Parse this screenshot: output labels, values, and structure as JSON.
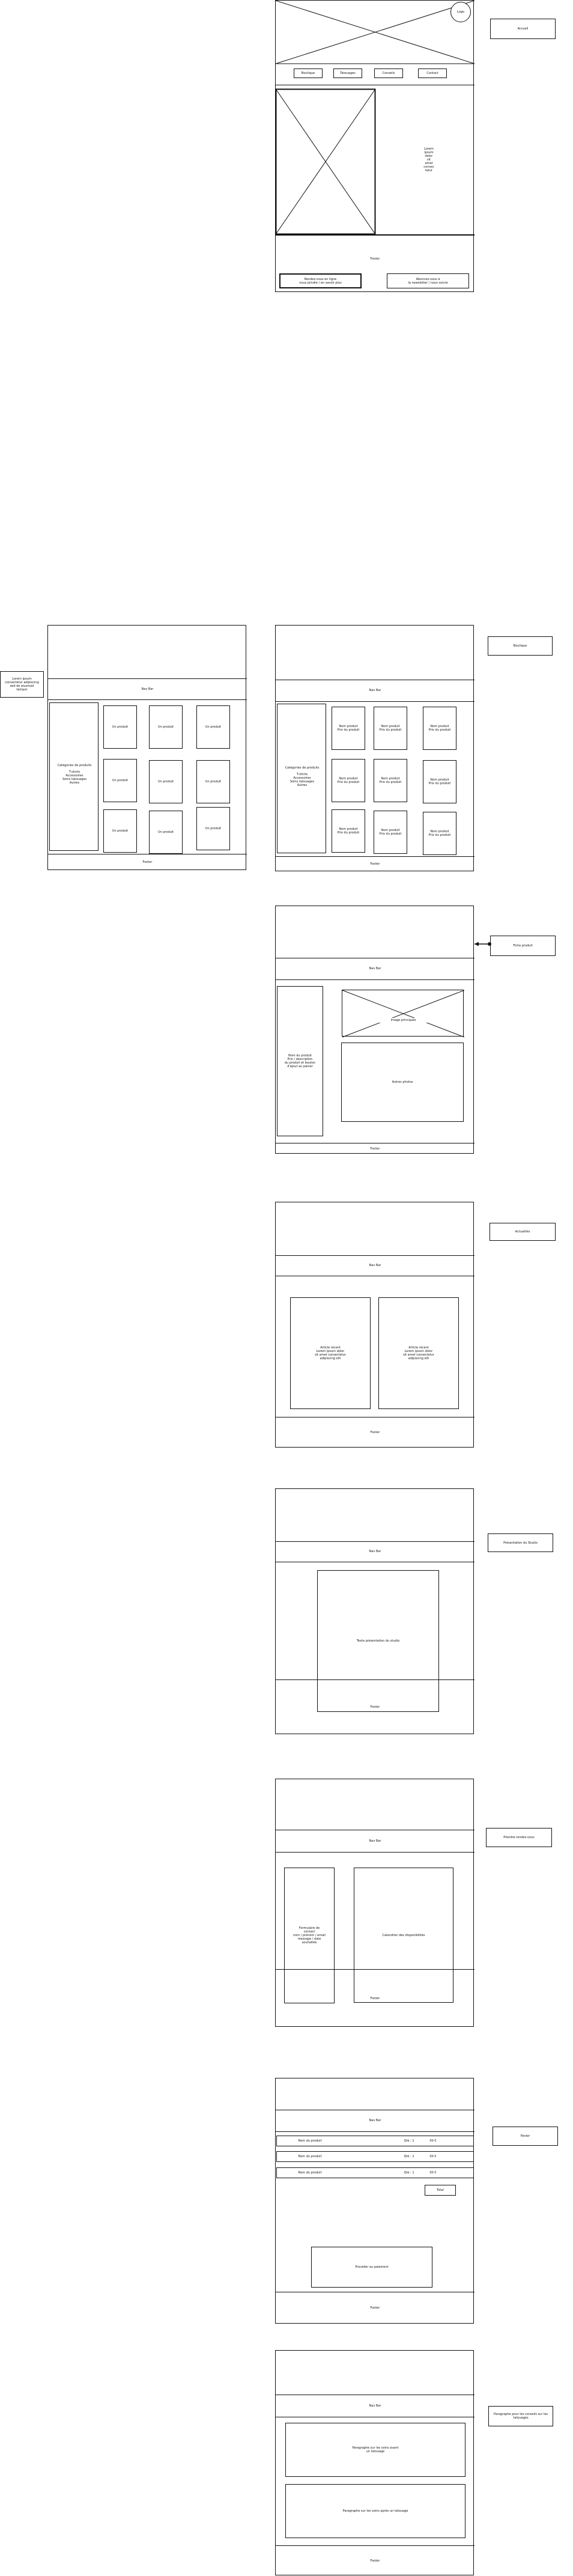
{
  "notes": {
    "home": "Accueil",
    "boutique": "Boutique",
    "produit": "Fiche produit",
    "actus": "Actualités",
    "presentation": "Présentation du Studio",
    "rdv": "Prendre rendez-vous",
    "panier": "Panier",
    "conseils": "Paragraphe pour les conseils sur les tatouages"
  },
  "side_note": "Lorem ipsum\nconsectetur adipiscing\nsed do eiusmod\ntempor",
  "common": {
    "footer": "Footer",
    "navbar": "Nav Bar",
    "logo": "Logo"
  },
  "home": {
    "nav": [
      "Boutique",
      "Tatouages",
      "Conseils",
      "Contact"
    ],
    "side_text": "Lorem\nipsum\ndolor\nsit\namet\nconsec\ntetur",
    "box_left": "Rendez-vous en ligne\nnous joindre / en savoir plus",
    "box_right": "Abonnez-vous à\nla newsletter / nous suivre"
  },
  "shop": {
    "filter_title": "Catégories de produits",
    "filter_text": "T-shirts\nAccessoires\nSoins tatouages\nAutres",
    "item": "Un produit",
    "item2": "Nom produit\nPrix du produit"
  },
  "product": {
    "description": "Nom du produit\nPrix / description\ndu produit et bouton\nd'ajout au panier",
    "main_image": "Image principale",
    "thumbs": "Autres photos"
  },
  "news": {
    "article1": "Article récent\nLorem ipsum dolor\nsit amet consectetur\nadipiscing elit",
    "article2": "Article récent\nLorem ipsum dolor\nsit amet consectetur\nadipiscing elit"
  },
  "studio": {
    "text": "Texte présentation du studio"
  },
  "rdv": {
    "left": "Formulaire de\ncontact\nnom / prénom / email\nmessage / date\nsouhaitée",
    "right": "Calendrier des disponibilités"
  },
  "cart": {
    "rows": [
      {
        "label": "Nom du produit",
        "qty": "Qté : 1",
        "price": "00 €"
      },
      {
        "label": "Nom du produit",
        "qty": "Qté : 1",
        "price": "00 €"
      },
      {
        "label": "Nom du produit",
        "qty": "Qté : 1",
        "price": "00 €"
      }
    ],
    "total": "Total",
    "checkout": "Procéder au paiement"
  },
  "tips": {
    "block1": "Paragraphe sur les soins avant\nun tatouage",
    "block2": "Paragraphe sur les soins après un tatouage"
  }
}
